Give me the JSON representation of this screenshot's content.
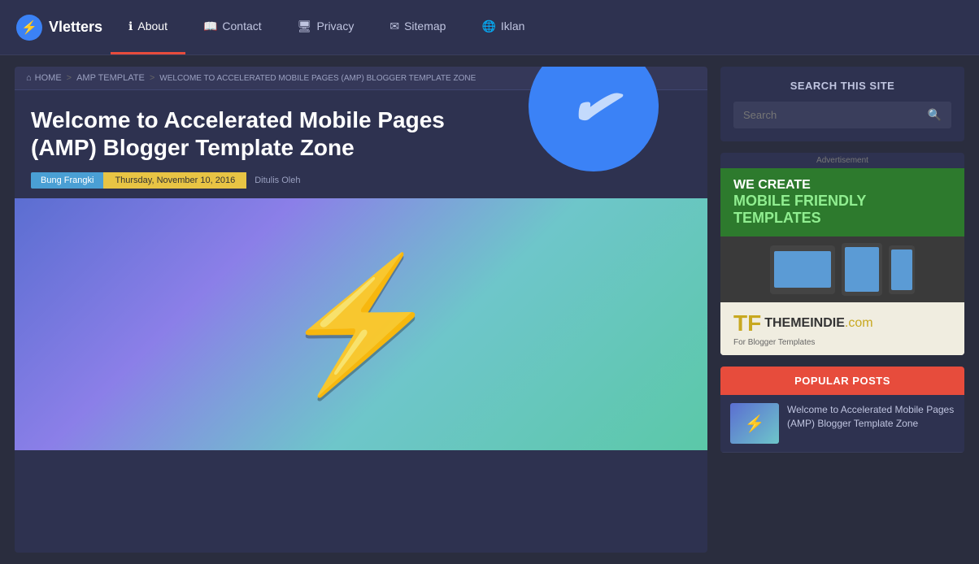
{
  "brand": {
    "name": "Vletters",
    "icon": "⚡"
  },
  "nav": {
    "items": [
      {
        "label": "About",
        "icon": "ℹ",
        "active": true
      },
      {
        "label": "Contact",
        "icon": "📖"
      },
      {
        "label": "Privacy",
        "icon": "🖥"
      },
      {
        "label": "Sitemap",
        "icon": "✉"
      },
      {
        "label": "Iklan",
        "icon": "🌐"
      }
    ]
  },
  "breadcrumb": {
    "home": "HOME",
    "sep1": ">",
    "section": "AMP TEMPLATE",
    "sep2": ">",
    "current": "WELCOME TO ACCELERATED MOBILE PAGES (AMP) BLOGGER TEMPLATE ZONE"
  },
  "post": {
    "title": "Welcome to Accelerated Mobile Pages (AMP) Blogger Template Zone",
    "author": "Bung Frangki",
    "date": "Thursday, November 10, 2016",
    "ditulis": "Ditulis Oleh"
  },
  "sidebar": {
    "search": {
      "title": "SEARCH THIS SITE",
      "placeholder": "Search",
      "button_icon": "🔍"
    },
    "advertisement": {
      "label": "Advertisement",
      "top_line1": "WE CREATE",
      "top_line2": "MOBILE FRIENDLY TEMPLATES",
      "bottom_brand": "THEMEINDIE",
      "bottom_tld": ".com",
      "bottom_sub": "For Blogger Templates"
    },
    "popular": {
      "title": "POPULAR POSTS",
      "items": [
        {
          "text": "Welcome to Accelerated Mobile Pages (AMP) Blogger Template Zone"
        }
      ]
    }
  }
}
